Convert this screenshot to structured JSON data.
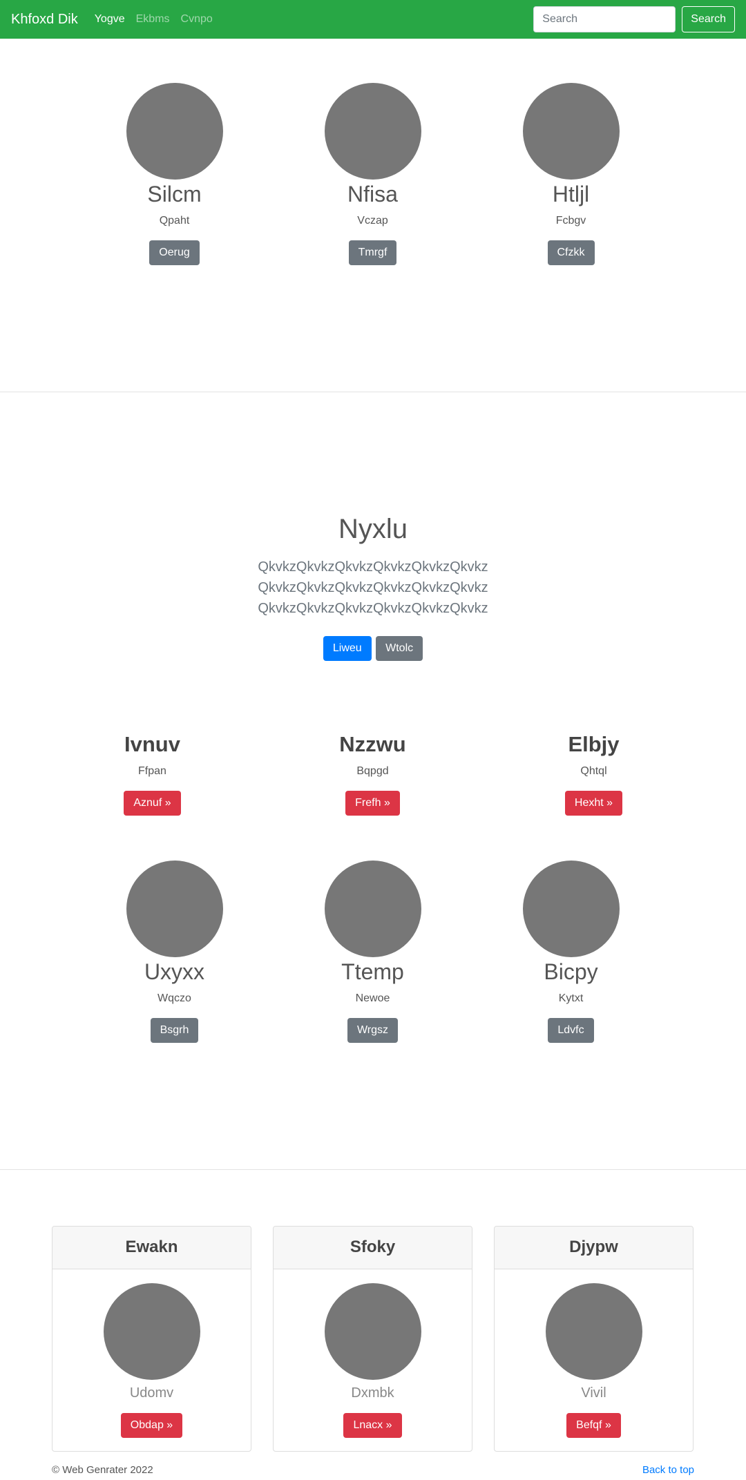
{
  "navbar": {
    "brand": "Khfoxd Dik",
    "links": [
      "Yogve",
      "Ekbms",
      "Cvnpo"
    ],
    "search_placeholder": "Search",
    "search_button": "Search"
  },
  "team_top": [
    {
      "name": "Silcm",
      "sub": "Qpaht",
      "button": "Oerug"
    },
    {
      "name": "Nfisa",
      "sub": "Vczap",
      "button": "Tmrgf"
    },
    {
      "name": "Htljl",
      "sub": "Fcbgv",
      "button": "Cfzkk"
    }
  ],
  "hero": {
    "title": "Nyxlu",
    "lines": [
      "QkvkzQkvkzQkvkzQkvkzQkvkzQkvkz",
      "QkvkzQkvkzQkvkzQkvkzQkvkzQkvkz",
      "QkvkzQkvkzQkvkzQkvkzQkvkzQkvkz"
    ],
    "primary_button": "Liweu",
    "secondary_button": "Wtolc"
  },
  "features": [
    {
      "title": "Ivnuv",
      "sub": "Ffpan",
      "button": "Aznuf »"
    },
    {
      "title": "Nzzwu",
      "sub": "Bqpgd",
      "button": "Frefh »"
    },
    {
      "title": "Elbjy",
      "sub": "Qhtql",
      "button": "Hexht »"
    }
  ],
  "team_bottom": [
    {
      "name": "Uxyxx",
      "sub": "Wqczo",
      "button": "Bsgrh"
    },
    {
      "name": "Ttemp",
      "sub": "Newoe",
      "button": "Wrgsz"
    },
    {
      "name": "Bicpy",
      "sub": "Kytxt",
      "button": "Ldvfc"
    }
  ],
  "cards": [
    {
      "header": "Ewakn",
      "sub": "Udomv",
      "button": "Obdap »"
    },
    {
      "header": "Sfoky",
      "sub": "Dxmbk",
      "button": "Lnacx »"
    },
    {
      "header": "Djypw",
      "sub": "Vivil",
      "button": "Befqf »"
    }
  ],
  "footer": {
    "copyright": "© Web Genrater 2022",
    "back_to_top": "Back to top"
  }
}
